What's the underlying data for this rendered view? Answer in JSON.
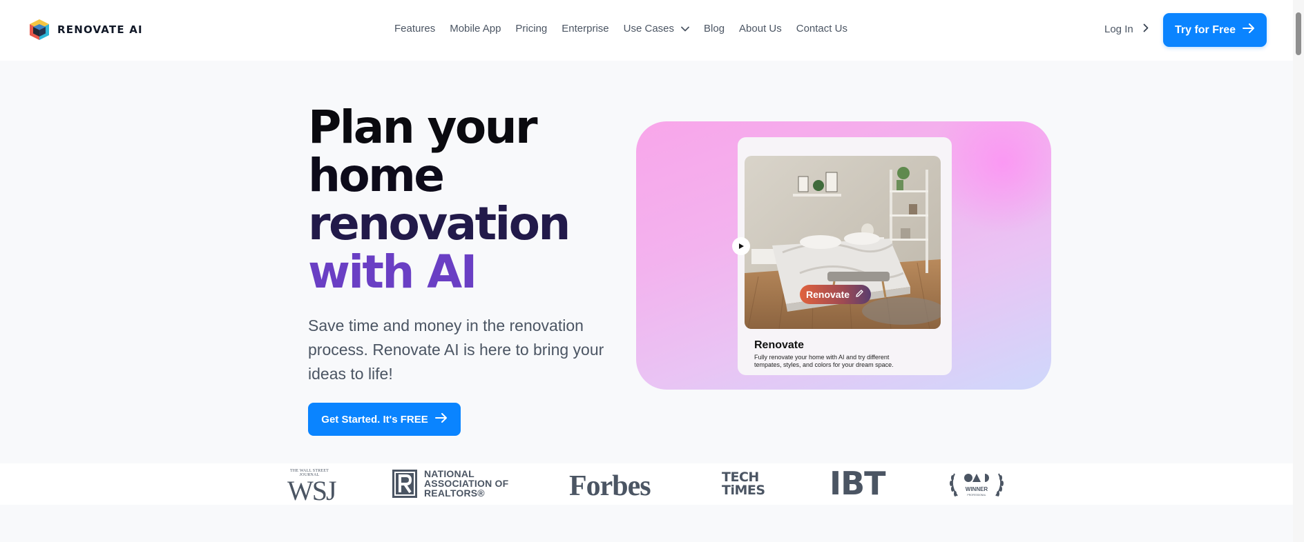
{
  "brand": {
    "name": "RENOVATE AI"
  },
  "nav": {
    "items": [
      {
        "label": "Features"
      },
      {
        "label": "Mobile App"
      },
      {
        "label": "Pricing"
      },
      {
        "label": "Enterprise"
      },
      {
        "label": "Use Cases",
        "has_dropdown": true
      },
      {
        "label": "Blog"
      },
      {
        "label": "About Us"
      },
      {
        "label": "Contact Us"
      }
    ],
    "login_label": "Log In",
    "cta_label": "Try for Free"
  },
  "hero": {
    "title_lines": [
      "Plan your",
      "home",
      "renovation",
      "with AI"
    ],
    "subtitle": "Save time and money in the renovation process. Renovate AI is here to bring your ideas to life!",
    "cta_label": "Get Started. It's FREE"
  },
  "feature_card": {
    "pill_label": "Renovate",
    "title": "Renovate",
    "description": "Fully renovate your home with AI and try different tempates, styles, and colors for your dream space."
  },
  "press": {
    "wsj_small": "THE WALL STREET JOURNAL",
    "wsj": "WSJ",
    "nar_lines": [
      "NATIONAL",
      "ASSOCIATION OF",
      "REALTORS®"
    ],
    "forbes": "Forbes",
    "tech_lines": [
      "TECH",
      "TiMES"
    ],
    "ibt": "IBT",
    "oda_label": "WINNER",
    "oda_sub": "PROFESSIONAL"
  },
  "colors": {
    "primary": "#0a84ff",
    "title_accent": "#6a3fc4",
    "nav_text": "#4b5563"
  }
}
